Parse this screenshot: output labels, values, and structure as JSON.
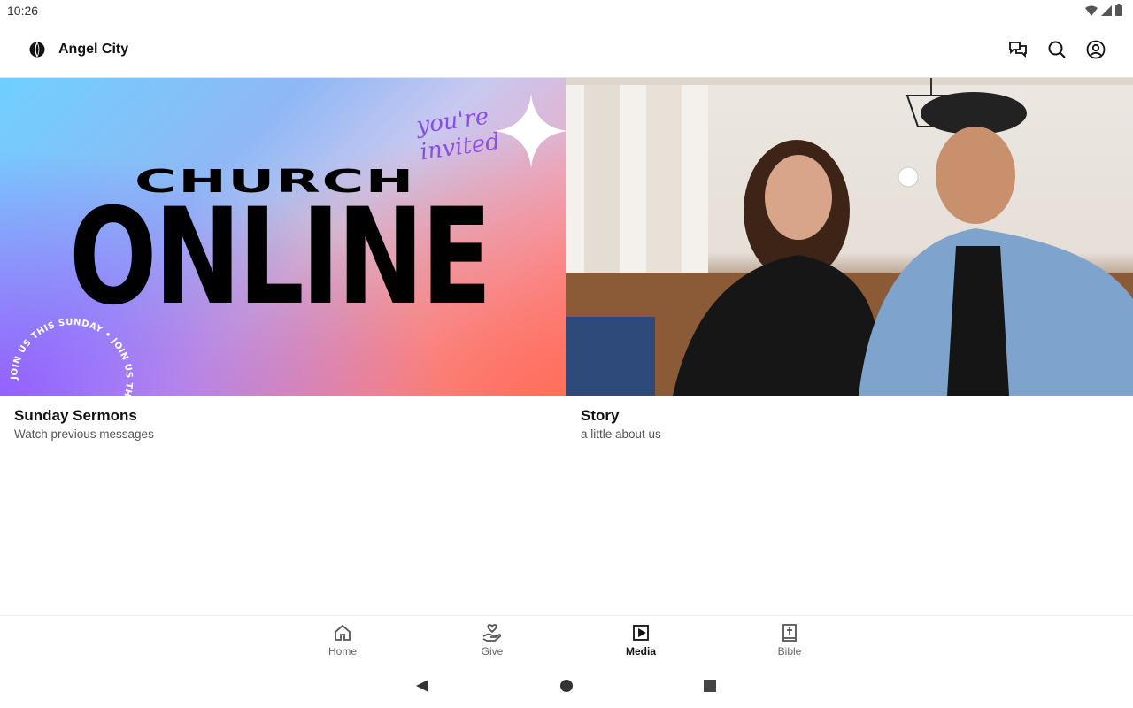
{
  "status": {
    "time": "10:26"
  },
  "app": {
    "title": "Angel City"
  },
  "cards": [
    {
      "title": "Sunday Sermons",
      "subtitle": "Watch previous messages",
      "thumbnail": {
        "headline_top": "CHURCH",
        "headline_main": "ONLINE",
        "script_text": "you're invited",
        "circle_text": "JOIN US THIS SUNDAY • JOIN US THIS SUNDAY • "
      }
    },
    {
      "title": "Story",
      "subtitle": "a little about us"
    }
  ],
  "bottom_nav": {
    "items": [
      {
        "label": "Home",
        "icon": "home-icon",
        "active": false
      },
      {
        "label": "Give",
        "icon": "give-icon",
        "active": false
      },
      {
        "label": "Media",
        "icon": "media-icon",
        "active": true
      },
      {
        "label": "Bible",
        "icon": "bible-icon",
        "active": false
      }
    ]
  },
  "colors": {
    "accent_script": "#8a4fe0",
    "active_nav": "#111111",
    "inactive_nav": "#666666"
  }
}
